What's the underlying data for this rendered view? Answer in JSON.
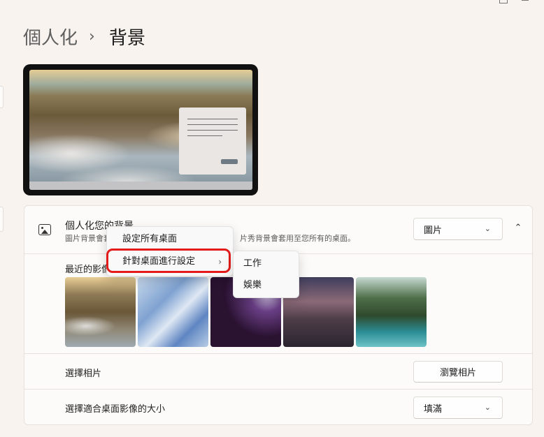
{
  "breadcrumb": {
    "parent": "個人化",
    "separator": "›",
    "current": "背景"
  },
  "background_section": {
    "title": "個人化您的背景",
    "description_start": "圖片背景會套",
    "description_end": "片秀背景會套用至您所有的桌面。",
    "dropdown_value": "圖片",
    "dropdown_chevron": "⌄",
    "collapse_chevron": "⌃",
    "recent_label": "最近的影像"
  },
  "recent_images": [
    "thumb-1",
    "thumb-2",
    "thumb-3",
    "thumb-4",
    "thumb-5"
  ],
  "choose_photo": {
    "label": "選擇相片",
    "button": "瀏覽相片"
  },
  "fit": {
    "label": "選擇適合桌面影像的大小",
    "dropdown_value": "填滿",
    "chevron": "⌄"
  },
  "context_menu": {
    "items": [
      {
        "label": "設定所有桌面"
      },
      {
        "label": "針對桌面進行設定",
        "arrow": "›"
      }
    ]
  },
  "submenu": {
    "items": [
      {
        "label": "工作"
      },
      {
        "label": "娛樂"
      }
    ]
  },
  "colors": {
    "highlight": "#e31b1b",
    "page_bg": "#f8f3ee",
    "card_bg": "#fdfbf9"
  },
  "icons": [
    "image-icon",
    "chevron-down-icon",
    "chevron-up-icon",
    "chevron-right-icon"
  ]
}
